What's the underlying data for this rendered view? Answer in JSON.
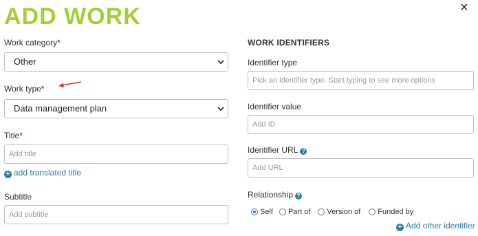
{
  "header": {
    "title": "ADD WORK",
    "close_label": "×"
  },
  "left": {
    "work_category": {
      "label": "Work category",
      "required_mark": "*",
      "value": "Other"
    },
    "work_type": {
      "label": "Work type",
      "required_mark": "*",
      "value": "Data management plan"
    },
    "title": {
      "label": "Title",
      "required_mark": "*",
      "placeholder": "Add title"
    },
    "add_translated_title": "add translated title",
    "subtitle": {
      "label": "Subtitle",
      "placeholder": "Add subtitle"
    }
  },
  "right": {
    "heading": "WORK IDENTIFIERS",
    "identifier_type": {
      "label": "Identifier type",
      "placeholder": "Pick an identifier type. Start typing to see more options"
    },
    "identifier_value": {
      "label": "Identifier value",
      "placeholder": "Add ID"
    },
    "identifier_url": {
      "label": "Identifier URL",
      "placeholder": "Add URL"
    },
    "relationship": {
      "label": "Relationship",
      "options": [
        {
          "label": "Self",
          "checked": true
        },
        {
          "label": "Part of",
          "checked": false
        },
        {
          "label": "Version of",
          "checked": false
        },
        {
          "label": "Funded by",
          "checked": false
        }
      ]
    },
    "add_other_identifier": "Add other identifier"
  },
  "icons": {
    "help": "?",
    "plus": "+"
  },
  "colors": {
    "title_green": "#a6ce39",
    "link_blue": "#2e7f9f",
    "required_red": "#b20000",
    "annotation_arrow": "#e0301e"
  }
}
